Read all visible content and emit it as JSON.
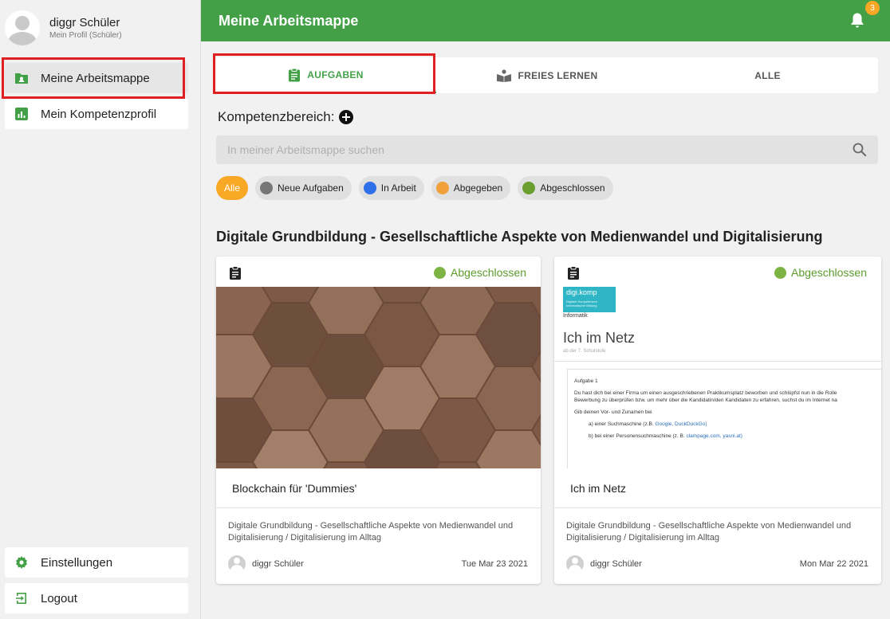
{
  "profile": {
    "name": "diggr Schüler",
    "subtitle": "Mein Profil (Schüler)"
  },
  "sidebar": {
    "items": [
      {
        "label": "Meine Arbeitsmappe",
        "icon": "folder-user-icon",
        "active": true
      },
      {
        "label": "Mein Kompetenzprofil",
        "icon": "bar-chart-icon",
        "active": false
      }
    ],
    "bottom": [
      {
        "label": "Einstellungen",
        "icon": "gear-icon"
      },
      {
        "label": "Logout",
        "icon": "logout-icon"
      }
    ]
  },
  "header": {
    "title": "Meine Arbeitsmappe",
    "notification_count": "3"
  },
  "tabs": [
    {
      "label": "AUFGABEN",
      "icon": "clipboard-icon",
      "active": true
    },
    {
      "label": "FREIES LERNEN",
      "icon": "reading-icon",
      "active": false
    },
    {
      "label": "ALLE",
      "active": false
    }
  ],
  "kompetenz_label": "Kompetenzbereich:",
  "search": {
    "placeholder": "In meiner Arbeitsmappe suchen",
    "value": ""
  },
  "filters": [
    {
      "label": "Alle",
      "color": "#f9a825",
      "active": true
    },
    {
      "label": "Neue Aufgaben",
      "color": "#757575"
    },
    {
      "label": "In Arbeit",
      "color": "#2f6fe8"
    },
    {
      "label": "Abgegeben",
      "color": "#f2a13a"
    },
    {
      "label": "Abgeschlossen",
      "color": "#6a9e2f"
    }
  ],
  "section_title": "Digitale Grundbildung - Gesellschaftliche Aspekte von Medienwandel und Digitalisierung",
  "cards": [
    {
      "status": "Abgeschlossen",
      "title": "Blockchain für 'Dummies'",
      "description": "Digitale Grundbildung - Gesellschaftliche Aspekte von Medienwandel und Digitalisierung / Digitalisierung im Alltag",
      "author": "diggr Schüler",
      "date": "Tue Mar 23 2021"
    },
    {
      "status": "Abgeschlossen",
      "title": "Ich im Netz",
      "description": "Digitale Grundbildung - Gesellschaftliche Aspekte von Medienwandel und Digitalisierung / Digitalisierung im Alltag",
      "author": "diggr Schüler",
      "date": "Mon Mar 22 2021",
      "preview": {
        "logo": "digi.komp",
        "logo_sub": "Digitale Kompetenzen Informatische Bildung",
        "subject": "Informatik",
        "title": "Ich im Netz",
        "level": "ab der 7. Schulstufe",
        "task_heading": "Aufgabe 1",
        "line1": "Du hast dich bei einer Firma um einen ausgeschriebenen Praktikumsplatz beworben und schlüpfst nun in die Rolle",
        "line2": "Bewerbung zu überprüfen bzw. um mehr über die Kandidatin/den Kandidaten zu erfahren, suchst du im Internet na",
        "line3": "Gib deinen Vor- und Zunamen bei",
        "item_a": "a) einer Suchmaschine (z.B. ",
        "item_a_link": "Google, DuckDuckGo)",
        "item_b": "b) bei einer Personensuchmaschine (z. B. ",
        "item_b_link": "clampage.com, yasni.at)"
      }
    }
  ]
}
